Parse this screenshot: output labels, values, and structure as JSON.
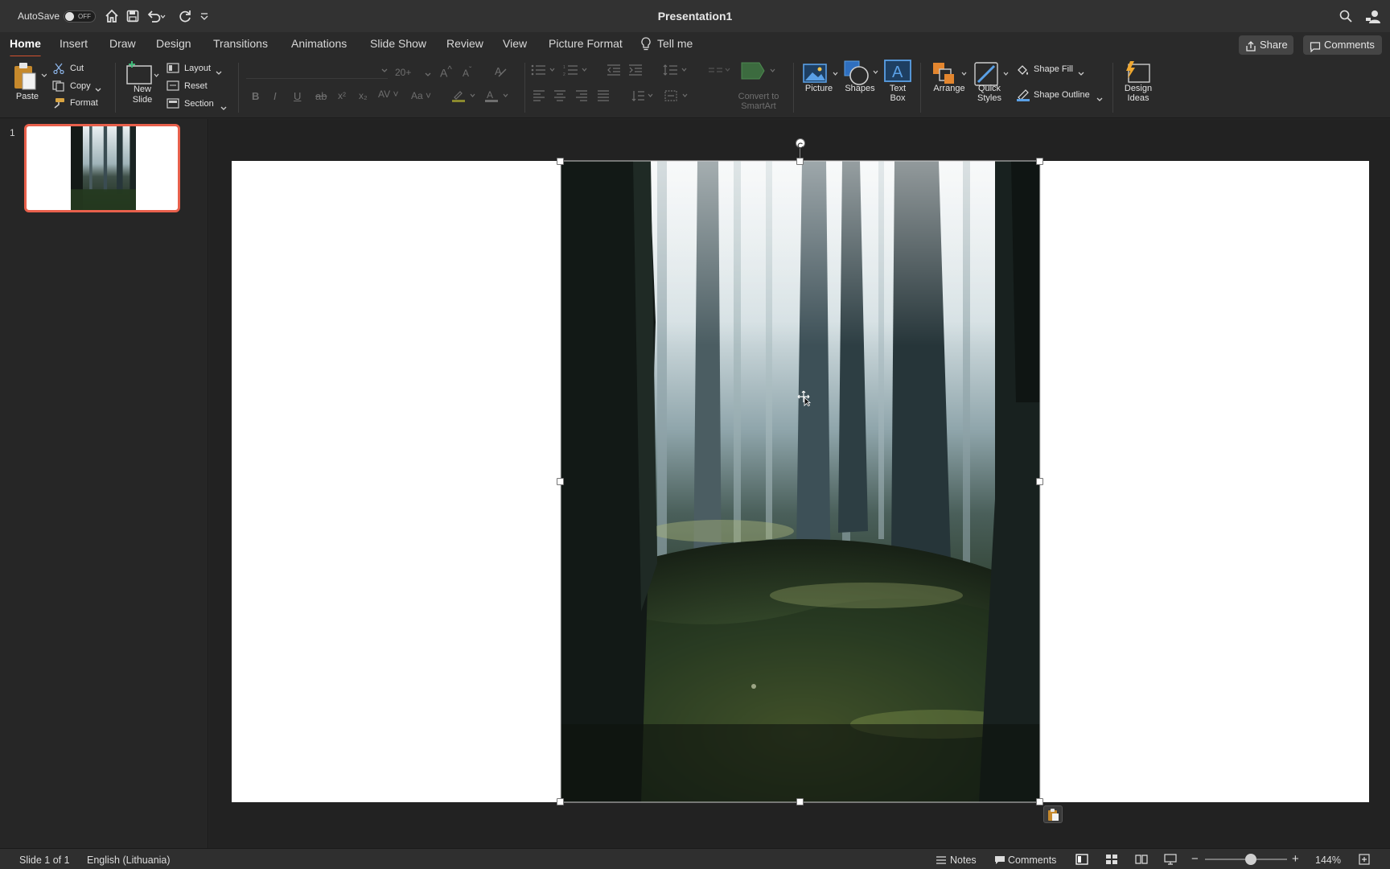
{
  "titlebar": {
    "autosave_label": "AutoSave",
    "autosave_state": "OFF",
    "title": "Presentation1"
  },
  "tabs": [
    "Home",
    "Insert",
    "Draw",
    "Design",
    "Transitions",
    "Animations",
    "Slide Show",
    "Review",
    "View",
    "Picture Format",
    "Tell me"
  ],
  "actions": {
    "share": "Share",
    "comments": "Comments"
  },
  "ribbon": {
    "paste": "Paste",
    "cut": "Cut",
    "copy": "Copy",
    "format": "Format",
    "new_slide_1": "New",
    "new_slide_2": "Slide",
    "layout": "Layout",
    "reset": "Reset",
    "section": "Section",
    "font_size": "20+",
    "convert_1": "Convert to",
    "convert_2": "SmartArt",
    "picture": "Picture",
    "shapes": "Shapes",
    "textbox_1": "Text",
    "textbox_2": "Box",
    "arrange": "Arrange",
    "quick_styles_1": "Quick",
    "quick_styles_2": "Styles",
    "shape_fill": "Shape Fill",
    "shape_outline": "Shape Outline",
    "design_ideas_1": "Design",
    "design_ideas_2": "Ideas"
  },
  "slides_panel": {
    "slide_number": "1"
  },
  "status": {
    "slide_info": "Slide 1 of 1",
    "language": "English (Lithuania)",
    "notes": "Notes",
    "comments": "Comments",
    "zoom": "144%"
  },
  "colors": {
    "accent": "#d35230",
    "thumb_border": "#e8604c",
    "app_bg": "#262626"
  }
}
